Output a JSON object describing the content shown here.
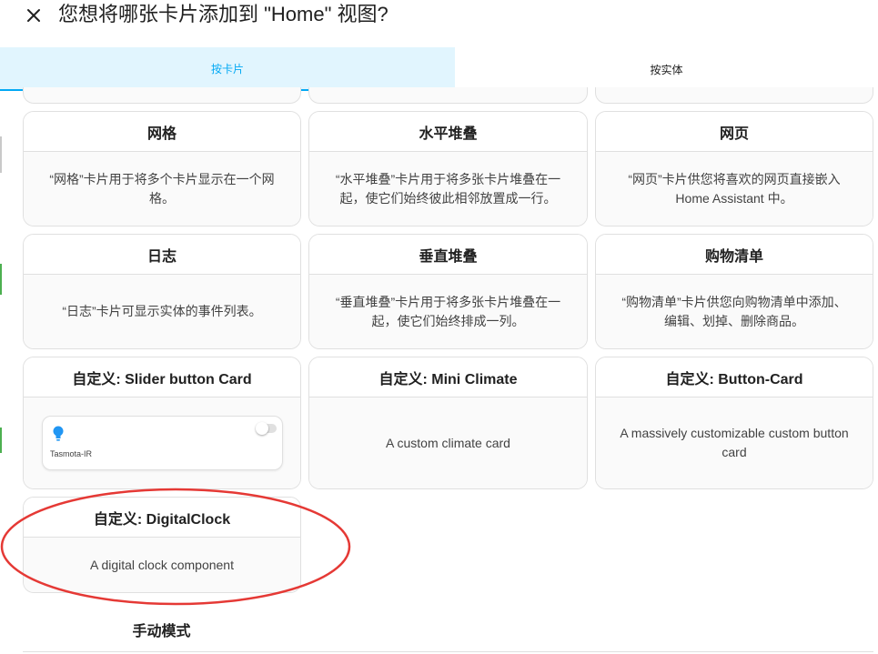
{
  "dialog": {
    "title": "您想将哪张卡片添加到 \"Home\" 视图?"
  },
  "tabs": [
    {
      "label": "按卡片",
      "active": true
    },
    {
      "label": "按实体",
      "active": false
    }
  ],
  "cards": [
    {
      "title": "网格",
      "description": "“网格”卡片用于将多个卡片显示在一个网格。"
    },
    {
      "title": "水平堆叠",
      "description": "“水平堆叠”卡片用于将多张卡片堆叠在一起，使它们始终彼此相邻放置成一行。"
    },
    {
      "title": "网页",
      "description": "“网页”卡片供您将喜欢的网页直接嵌入 Home Assistant 中。"
    },
    {
      "title": "日志",
      "description": "“日志”卡片可显示实体的事件列表。"
    },
    {
      "title": "垂直堆叠",
      "description": "“垂直堆叠”卡片用于将多张卡片堆叠在一起，使它们始终排成一列。"
    },
    {
      "title": "购物清单",
      "description": "“购物清单”卡片供您向购物清单中添加、编辑、划掉、删除商品。"
    },
    {
      "title": "自定义: Slider button Card",
      "preview_label": "Tasmota-IR"
    },
    {
      "title": "自定义: Mini Climate",
      "description": "A custom climate card"
    },
    {
      "title": "自定义: Button-Card",
      "description": "A massively customizable custom button card"
    },
    {
      "title": "自定义: DigitalClock",
      "description": "A digital clock component"
    }
  ],
  "manual": {
    "title": "手动模式"
  },
  "colors": {
    "accent": "#03a9f4",
    "tab_active_bg": "#e1f5fe",
    "annotation": "#e53935",
    "bulb": "#2196f3"
  }
}
